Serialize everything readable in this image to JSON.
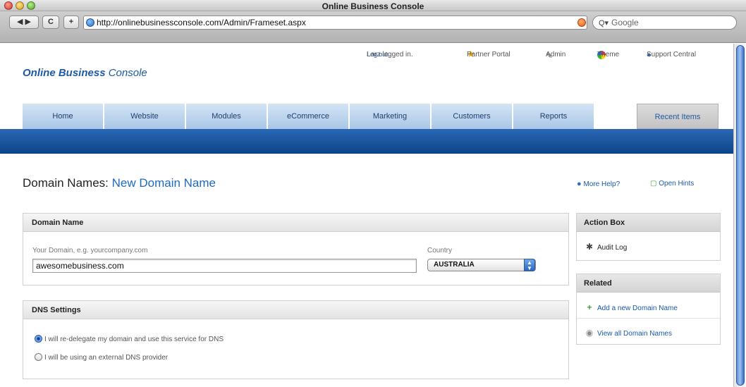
{
  "window": {
    "title": "Online Business Console"
  },
  "toolbar": {
    "back_forward": "◀ ▶",
    "reload": "C",
    "add": "+",
    "url": "http://onlinebusinessconsole.com/Admin/Frameset.aspx",
    "search_placeholder": "Google",
    "search_glyph": "Q▾"
  },
  "header": {
    "login_status": "Larz logged in.",
    "logout": "Log out.",
    "partner_portal": "Partner Portal",
    "admin": "Admin",
    "theme": "Theme",
    "support": "Support Central",
    "logo_bold": "Online Business",
    "logo_rest": " Console"
  },
  "nav": {
    "items": [
      "Home",
      "Website",
      "Modules",
      "eCommerce",
      "Marketing",
      "Customers",
      "Reports"
    ],
    "recent": "Recent Items"
  },
  "page": {
    "title": "Domain Names:",
    "subtitle": "New Domain Name",
    "more_help": "More Help?",
    "open_hints": "Open Hints"
  },
  "domain_panel": {
    "heading": "Domain Name",
    "domain_label": "Your Domain, e.g. yourcompany.com",
    "domain_value": "awesomebusiness.com",
    "country_label": "Country",
    "country_value": "AUSTRALIA"
  },
  "dns_panel": {
    "heading": "DNS Settings",
    "option_1": "I will re-delegate my domain and use this service for DNS",
    "option_2": "I will be using an external DNS provider",
    "selected": 1
  },
  "action_box": {
    "heading": "Action Box",
    "audit_log": "Audit Log"
  },
  "related": {
    "heading": "Related",
    "add_domain": "Add a new Domain Name",
    "view_all": "View all Domain Names"
  },
  "colors": {
    "brand_blue": "#1f5aa8",
    "bar_blue": "#0d4488",
    "nav_light": "#a9c6e6"
  }
}
